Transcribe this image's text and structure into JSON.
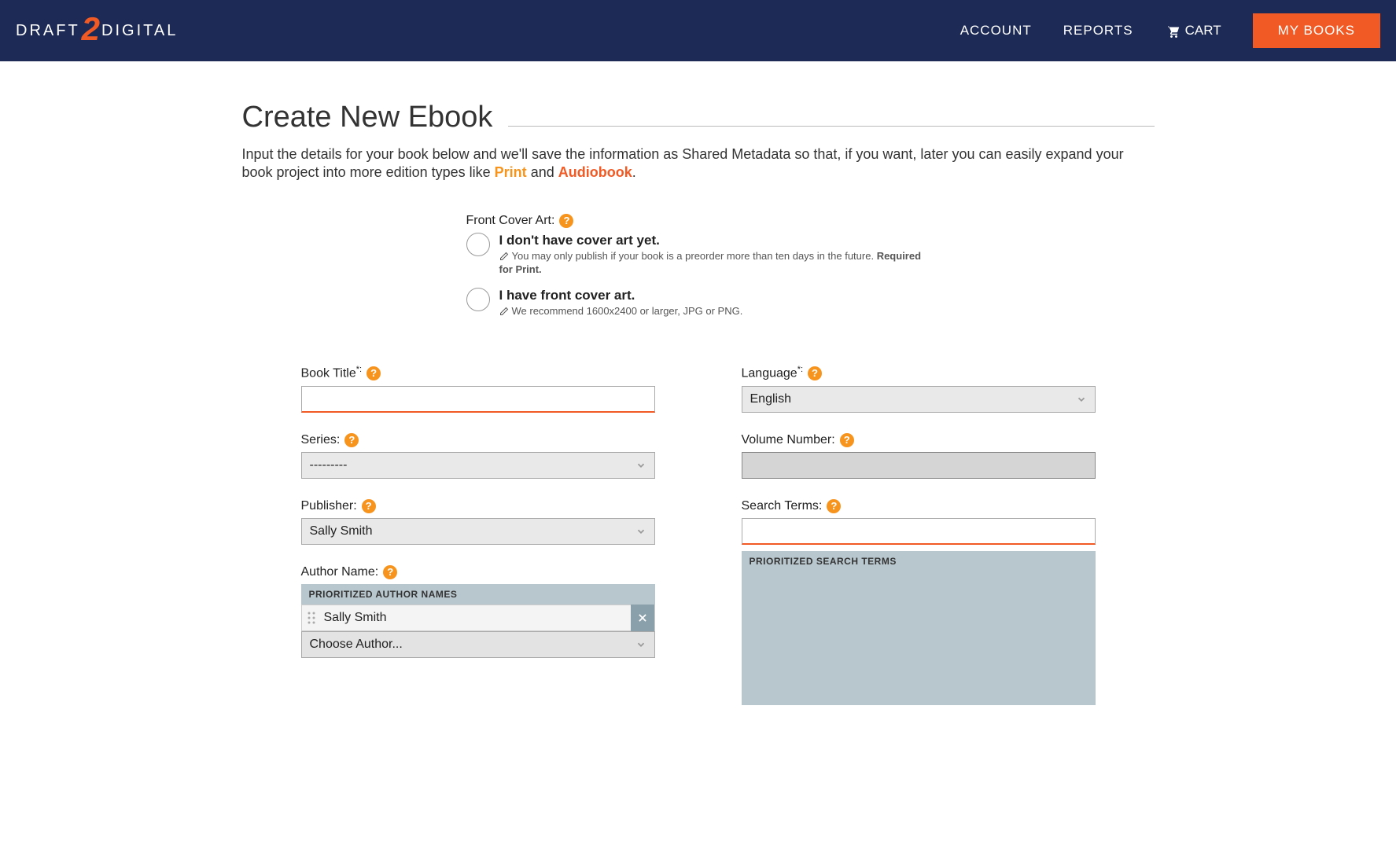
{
  "logo": {
    "left": "DRAFT",
    "middle": "2",
    "right": "DIGITAL"
  },
  "nav": {
    "account": "ACCOUNT",
    "reports": "REPORTS",
    "cart": "CART",
    "mybooks": "MY BOOKS"
  },
  "page": {
    "title": "Create New Ebook",
    "intro_a": "Input the details for your book below and we'll save the information as Shared Metadata so that, if you want, later you can easily expand your book project into more edition types like ",
    "intro_print": "Print",
    "intro_and": " and ",
    "intro_audio": "Audiobook",
    "intro_end": "."
  },
  "cover": {
    "label": "Front Cover Art:",
    "opt1_title": "I don't have cover art yet.",
    "opt1_sub_a": "You may only publish if your book is a preorder more than ten days in the future. ",
    "opt1_sub_b": "Required for Print.",
    "opt2_title": "I have front cover art.",
    "opt2_sub": "We recommend 1600x2400 or larger, JPG or PNG."
  },
  "labels": {
    "book_title": "Book Title",
    "series": "Series:",
    "publisher": "Publisher:",
    "author_name": "Author Name:",
    "language": "Language",
    "volume": "Volume Number:",
    "search_terms": "Search Terms:"
  },
  "values": {
    "series": "---------",
    "publisher": "Sally Smith",
    "language": "English",
    "choose_author": "Choose Author...",
    "author1": "Sally Smith"
  },
  "headers": {
    "author_names": "PRIORITIZED AUTHOR NAMES",
    "search_terms": "PRIORITIZED SEARCH TERMS"
  },
  "glyphs": {
    "colon_star": "*:"
  }
}
